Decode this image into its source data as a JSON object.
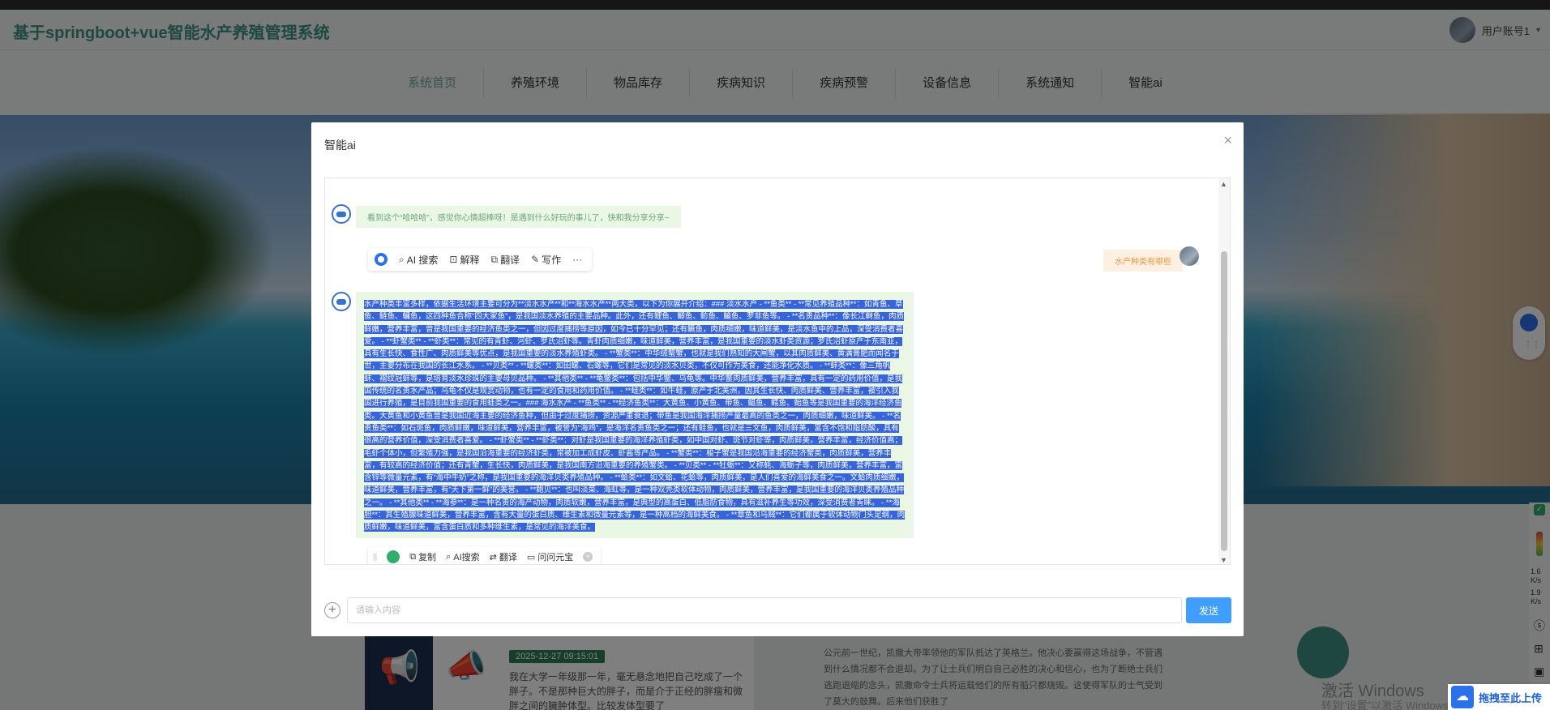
{
  "header": {
    "site_title": "基于springboot+vue智能水产养殖管理系统",
    "user_label": "用户账号1",
    "caret": "▾"
  },
  "nav": {
    "items": [
      {
        "label": "系统首页",
        "active": true
      },
      {
        "label": "养殖环境"
      },
      {
        "label": "物品库存"
      },
      {
        "label": "疾病知识"
      },
      {
        "label": "疾病预警"
      },
      {
        "label": "设备信息"
      },
      {
        "label": "系统通知"
      },
      {
        "label": "智能ai"
      }
    ]
  },
  "background": {
    "card_date": "2025-12-27 09:15:01",
    "card_text": "我在大学一年级那一年，毫无悬念地把自己吃成了一个胖子。不是那种巨大的胖子，而是介于正经的胖瘦和微胖之间的臃肿体型。比较发体型要了",
    "right_text": "公元前一世纪，凯撒大帝率领他的军队抵达了英格兰。他决心要赢得这场战争，不管遇到什么情况都不会退却。为了让士兵们明白自己必胜的决心和信心，也为了断绝士兵们逃跑退缩的念头，凯撒命令士兵将运载他们的所有船只都烧毁。这使得军队的士气受到了莫大的鼓舞。后来他们获胜了",
    "watermark": "激活 Windows",
    "watermark_sub": "转到\"设置\"以激活 Windows。",
    "upload_label": "拖拽至此上传",
    "tray_speed_1": "1.6",
    "tray_speed_1_unit": "K/s",
    "tray_speed_2": "1.9",
    "tray_speed_2_unit": "K/s"
  },
  "modal": {
    "title": "智能ai",
    "close": "×",
    "messages": {
      "greeting": "看到这个“哈哈哈”，感觉你心情超棒呀！是遇到什么好玩的事儿了，快和我分享分享~",
      "user_question": "水产种类有哪些",
      "answer": "水产种类丰富多样，依据生活环境主要可分为**淡水水产**和**海水水产**两大类，以下为你展开介绍：### 淡水水产 - **鱼类** - **常见养殖品种**：如青鱼、草鱼、鲢鱼、鳙鱼，这四种鱼合称“四大家鱼”，是我国淡水养殖的主要品种。此外，还有鲤鱼、鲫鱼、鲂鱼、鳊鱼、罗非鱼等。 - **名贵品种**：像长江鲥鱼，肉质鲜嫩，营养丰富，曾是我国重要的经济鱼类之一，但因过度捕捞等原因，如今已十分罕见；还有鳜鱼，肉质细嫩，味道鲜美，是淡水鱼中的上品，深受消费者喜爱。 - **虾蟹类** - **虾类**：常见的有青虾、河虾、罗氏沼虾等。青虾肉质细嫩，味道鲜美，营养丰富，是我国重要的淡水虾类资源；罗氏沼虾原产于东南亚，具有生长快、食性广、肉质鲜美等优点，是我国重要的淡水养殖虾类。 - **蟹类**：中华绒螯蟹，也就是我们熟知的大闸蟹，以其肉质鲜美、黄满膏肥而闻名于世，主要分布在我国的长江水系。 - **贝类** - **螺类**：如田螺、石螺等，它们是常见的淡水贝类，不仅可作为美食，还能净化水质。 - **蚌类**：像三角帆蚌、褶纹冠蚌等，是培育淡水珍珠的主要母贝品种。 - **其他类** - **龟鳖类**：包括中华鳖、乌龟等。中华鳖肉质鲜美，营养丰富，具有一定的药用价值，是我国传统的名贵水产品；乌龟不仅是观赏动物，也有一定的食用和药用价值。 - **蛙类**：如牛蛙，原产于北美洲，因其生长快、肉质鲜美、营养丰富，被引入我国进行养殖，是目前我国重要的食用蛙类之一。### 海水水产 - **鱼类** - **经济鱼类**：大黄鱼、小黄鱼、带鱼、鲳鱼、鳕鱼、鲐鱼等是我国重要的海洋经济鱼类。大黄鱼和小黄鱼曾是我国近海主要的经济鱼种，但由于过度捕捞，资源严重衰退；带鱼是我国海洋捕捞产量最高的鱼类之一，肉质细嫩，味道鲜美。 - **名贵鱼类**：如石斑鱼，肉质鲜嫩，味道鲜美，营养丰富，被誉为“海鸡”，是海洋名贵鱼类之一；还有鲑鱼，也就是三文鱼，肉质鲜美，富含不饱和脂肪酸，具有很高的营养价值，深受消费者喜爱。 - **虾蟹类** - **虾类**：对虾是我国重要的海洋养殖虾类，如中国对虾、斑节对虾等，肉质鲜美，营养丰富，经济价值高；毛虾个体小，但繁殖力强，是我国沿海重要的经济虾类，常被加工成虾皮、虾酱等产品。 - **蟹类**：梭子蟹是我国沿海重要的经济蟹类，肉质鲜美，营养丰富，有较高的经济价值；还有青蟹，生长快，肉质鲜美，是我国南方沿海重要的养殖蟹类。 - **贝类** - **牡蛎**：又称蚝、海蛎子等，肉质鲜美，营养丰富，富含锌等微量元素，有“海中牛奶”之称，是我国重要的海洋贝类养殖品种。 - **蛤类**：如文蛤、花蛤等，肉质鲜美，是人们喜爱的海鲜美食之一。文蛤肉质细嫩，味道鲜美，营养丰富，有“天下第一鲜”的美誉。 - **鲍贝**：也叫淡菜、海虹等，是一种双壳类软体动物，肉质鲜美，营养丰富，是我国重要的海洋贝类养殖品种之一。 - **其他类** - **海参**：是一种名贵的海产动物，肉质软嫩，营养丰富，是典型的高蛋白、低脂肪食物，具有滋补养生等功效，深受消费者青睐。 - **海胆**：其生殖腺味道鲜美，营养丰富，含有大量的蛋白质、维生素和微量元素等，是一种高档的海鲜美食。 - **章鱼和乌贼**：它们都属于软体动物门头足纲，肉质鲜嫩，味道鲜美，富含蛋白质和多种维生素，是常见的海洋美食。"
    },
    "toolbar": {
      "items": [
        {
          "label": "AI 搜索",
          "icon": "⌕"
        },
        {
          "label": "解释",
          "icon": "⊡"
        },
        {
          "label": "翻译",
          "icon": "⧉"
        },
        {
          "label": "写作",
          "icon": "✎"
        }
      ],
      "more": "···"
    },
    "action_bar": {
      "grip": "||",
      "items": [
        {
          "label": "复制",
          "icon": "⧉"
        },
        {
          "label": "AI搜索",
          "icon": "⌕"
        },
        {
          "label": "翻译",
          "icon": "⇄"
        },
        {
          "label": "问问元宝",
          "icon": "▭"
        }
      ],
      "close": "×"
    },
    "input": {
      "plus": "+",
      "placeholder": "请输入内容",
      "value": "",
      "send_label": "发送"
    }
  }
}
